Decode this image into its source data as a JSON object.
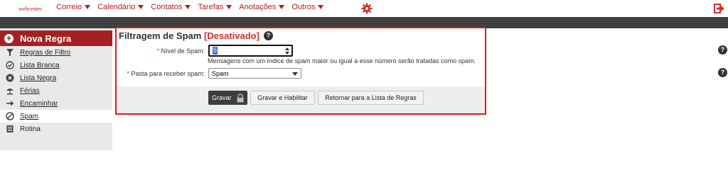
{
  "topbar": {
    "logo": "webcenter",
    "nav": [
      "Correio",
      "Calendário",
      "Contatos",
      "Tarefas",
      "Anotações",
      "Outros"
    ],
    "gear_icon": "gear-icon",
    "logout_icon": "logout-icon",
    "accent": "#b71c1c"
  },
  "sidebar": {
    "header": "Nova Regra",
    "items": [
      {
        "label": "Regras de Filtro",
        "icon": "filter-icon"
      },
      {
        "label": "Lista Branca",
        "icon": "check-circle-icon"
      },
      {
        "label": "Lista Negra",
        "icon": "x-circle-icon"
      },
      {
        "label": "Férias",
        "icon": "vacation-icon"
      },
      {
        "label": "Encaminhar",
        "icon": "arrow-right-icon"
      },
      {
        "label": "Spam",
        "icon": "no-entry-icon"
      },
      {
        "label": "Rotina",
        "icon": "list-icon"
      }
    ],
    "active": "Spam"
  },
  "main": {
    "title": "Filtragem de Spam",
    "status": "[Desativado]",
    "spam_level": {
      "label": "Nível de Spam:",
      "value": "5",
      "hint": "Mensagens com um índice de spam maior ou igual a esse número serão tratadas como spam."
    },
    "folder": {
      "label": "Pasta para receber spam:",
      "value": "Spam"
    },
    "buttons": {
      "save": "Gravar",
      "save_enable": "Gravar e Habilitar",
      "back": "Retornar para a Lista de Regras"
    },
    "required_mark": "*",
    "help_mark": "?"
  }
}
